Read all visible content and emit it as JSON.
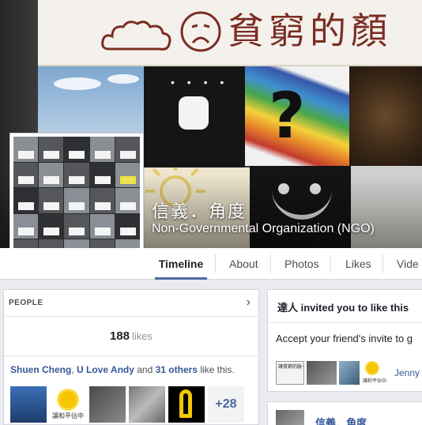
{
  "cover": {
    "banner_text": "貧窮的顏",
    "page_name": "信義．角度",
    "page_category": "Non-Governmental Organization (NGO)",
    "question_mark": "?"
  },
  "tabs": [
    {
      "label": "Timeline",
      "active": true
    },
    {
      "label": "About",
      "active": false
    },
    {
      "label": "Photos",
      "active": false
    },
    {
      "label": "Likes",
      "active": false
    },
    {
      "label": "Vide",
      "active": false
    }
  ],
  "people": {
    "title": "PEOPLE",
    "chevron": "›",
    "likes_count": "188",
    "likes_word": "likes",
    "friend1": "Shuen Cheng",
    "sep": ", ",
    "friend2": "U Love Andy",
    "and": " and ",
    "others": "31 others",
    "tail": " like this.",
    "more_count": "+28",
    "flower_caption": "讓和平佔中"
  },
  "invite": {
    "inviter": "達人",
    "text": " invited you to like this",
    "body": "Accept your friend's invite to g",
    "thumb_caption": "讓貧窮的臉一起走出",
    "flower_caption": "讓和平佔中",
    "friend_name": "Jenny K"
  },
  "post": {
    "name": "信義．角度"
  }
}
